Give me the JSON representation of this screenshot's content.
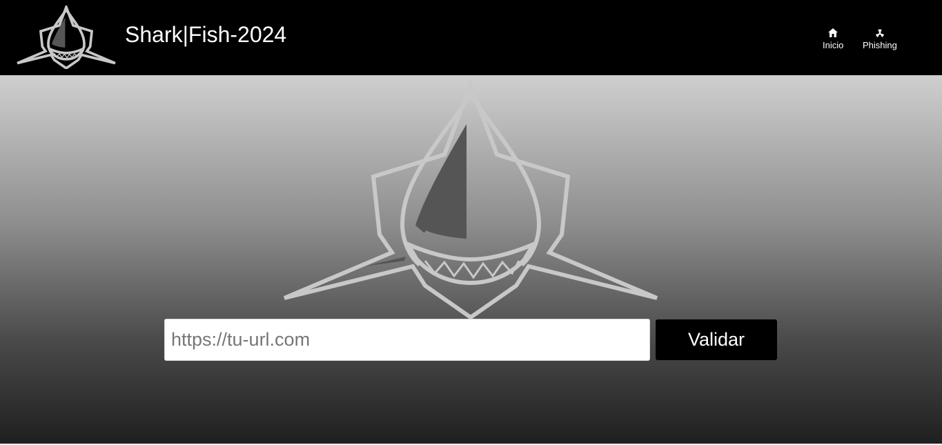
{
  "header": {
    "logo_icon": "shark-logo-icon",
    "title": "Shark|Fish-2024"
  },
  "nav": {
    "items": [
      {
        "label": "Inicio",
        "icon": "home-icon"
      },
      {
        "label": "Phishing",
        "icon": "radiation-icon"
      }
    ]
  },
  "hero": {
    "logo_icon": "shark-emblem-icon"
  },
  "form": {
    "url_placeholder": "https://tu-url.com",
    "url_value": "",
    "submit_label": "Validar"
  },
  "colors": {
    "header_bg": "#000000",
    "button_bg": "#000000",
    "text_light": "#ffffff",
    "emblem_outline": "#c8c8c8",
    "emblem_fin": "#555555"
  }
}
